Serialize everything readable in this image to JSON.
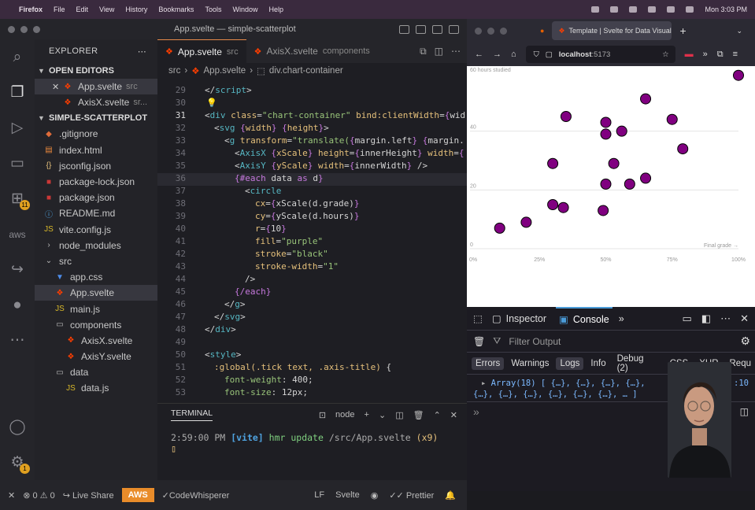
{
  "menubar": {
    "app": "Firefox",
    "items": [
      "File",
      "Edit",
      "View",
      "History",
      "Bookmarks",
      "Tools",
      "Window",
      "Help"
    ],
    "clock": "Mon 3:03 PM"
  },
  "vscode": {
    "window_title": "App.svelte — simple-scatterplot",
    "explorer": {
      "title": "EXPLORER",
      "open_editors_label": "OPEN EDITORS",
      "open_editors": [
        {
          "name": "App.svelte",
          "sub": "src"
        },
        {
          "name": "AxisX.svelte",
          "sub": "sr..."
        }
      ],
      "project_label": "SIMPLE-SCATTERPLOT",
      "files": [
        {
          "name": ".gitignore",
          "icon": "git"
        },
        {
          "name": "index.html",
          "icon": "html"
        },
        {
          "name": "jsconfig.json",
          "icon": "json"
        },
        {
          "name": "package-lock.json",
          "icon": "npm"
        },
        {
          "name": "package.json",
          "icon": "npm"
        },
        {
          "name": "README.md",
          "icon": "info"
        },
        {
          "name": "vite.config.js",
          "icon": "js"
        },
        {
          "name": "node_modules",
          "icon": "chevron"
        },
        {
          "name": "src",
          "icon": "chevron-down"
        },
        {
          "name": "app.css",
          "icon": "css"
        },
        {
          "name": "App.svelte",
          "icon": "svelte"
        },
        {
          "name": "main.js",
          "icon": "js"
        },
        {
          "name": "components",
          "icon": "folder"
        },
        {
          "name": "AxisX.svelte",
          "icon": "svelte"
        },
        {
          "name": "AxisY.svelte",
          "icon": "svelte"
        },
        {
          "name": "data",
          "icon": "folder"
        },
        {
          "name": "data.js",
          "icon": "js"
        }
      ]
    },
    "tabs": [
      {
        "name": "App.svelte",
        "sub": "src"
      },
      {
        "name": "AxisX.svelte",
        "sub": "components"
      }
    ],
    "breadcrumb": [
      "src",
      "App.svelte",
      "div.chart-container"
    ],
    "line_numbers": [
      "29",
      "30",
      "31",
      "32",
      "33",
      "34",
      "35",
      "36",
      "37",
      "38",
      "39",
      "40",
      "41",
      "42",
      "43",
      "44",
      "45",
      "46",
      "47",
      "48",
      "49",
      "50",
      "51",
      "52",
      "53"
    ],
    "terminal": {
      "label": "TERMINAL",
      "shell": "node",
      "time": "2:59:00 PM",
      "tag": "[vite]",
      "msg": "hmr update",
      "path": "/src/App.svelte",
      "count": "(x9)"
    },
    "status": {
      "errors": "0",
      "warnings": "0",
      "live_share": "Live Share",
      "aws": "AWS",
      "codewhisperer": "CodeWhisperer",
      "eol": "LF",
      "lang": "Svelte",
      "prettier": "Prettier"
    },
    "extension_badge": "11",
    "account_badge": "1"
  },
  "browser": {
    "tab_title": "Template | Svelte for Data Visual",
    "url_host": "localhost",
    "url_port": ":5173",
    "devtools": {
      "tabs": [
        "Inspector",
        "Console"
      ],
      "filter_placeholder": "Filter Output",
      "levels": [
        "Errors",
        "Warnings",
        "Logs",
        "Info",
        "Debug (2)",
        "CSS",
        "XHR",
        "Requ"
      ],
      "log_line1": "Array(18) [ {…}, {…}, {…}, {…},",
      "log_line2": "{…}, {…}, {…}, {…}, {…}, {…}, … ]",
      "log_suffix": ":10"
    }
  },
  "chart_data": {
    "type": "scatter",
    "ylabel": "60 hours studied",
    "xlabel": "Final grade →",
    "xlim": [
      0,
      100
    ],
    "ylim": [
      0,
      60
    ],
    "x_ticks": [
      "0%",
      "25%",
      "50%",
      "75%",
      "100%"
    ],
    "y_ticks": [
      "0",
      "20",
      "40"
    ],
    "point_color": "purple",
    "points": [
      {
        "x": 10,
        "y": 7
      },
      {
        "x": 20,
        "y": 9
      },
      {
        "x": 30,
        "y": 15
      },
      {
        "x": 34,
        "y": 14
      },
      {
        "x": 30,
        "y": 29
      },
      {
        "x": 35,
        "y": 45
      },
      {
        "x": 49,
        "y": 13
      },
      {
        "x": 50,
        "y": 22
      },
      {
        "x": 50,
        "y": 39
      },
      {
        "x": 50,
        "y": 43
      },
      {
        "x": 53,
        "y": 29
      },
      {
        "x": 56,
        "y": 40
      },
      {
        "x": 59,
        "y": 22
      },
      {
        "x": 65,
        "y": 24
      },
      {
        "x": 65,
        "y": 51
      },
      {
        "x": 75,
        "y": 44
      },
      {
        "x": 79,
        "y": 34
      },
      {
        "x": 100,
        "y": 59
      }
    ]
  }
}
